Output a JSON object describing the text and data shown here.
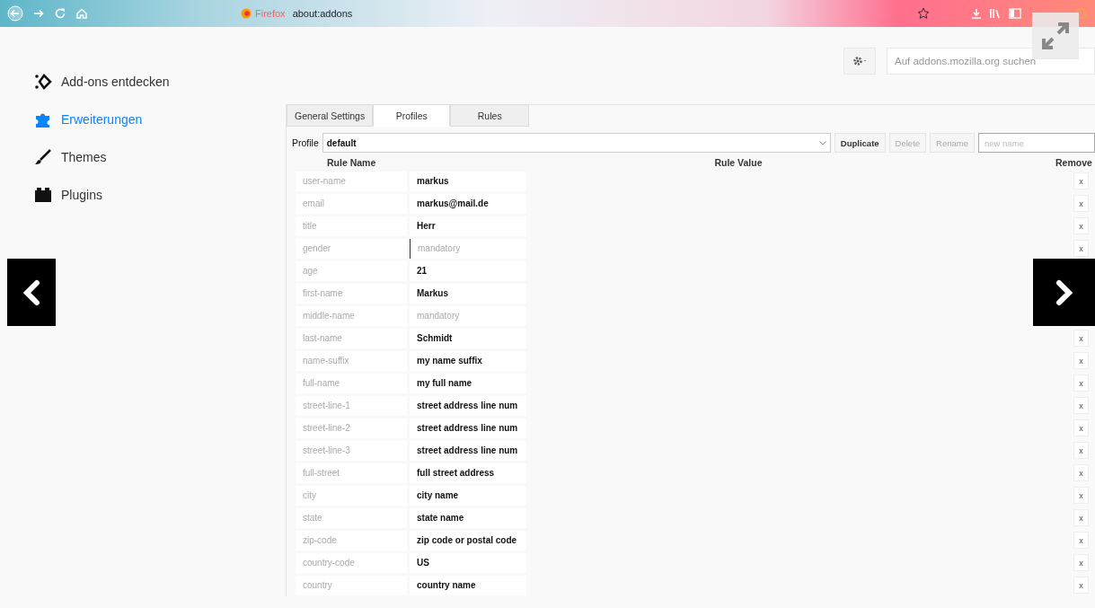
{
  "browser": {
    "identity_label": "Firefox",
    "url": "about:addons"
  },
  "sidebar": {
    "items": [
      {
        "label": "Add-ons entdecken",
        "selected": false
      },
      {
        "label": "Erweiterungen",
        "selected": true
      },
      {
        "label": "Themes",
        "selected": false
      },
      {
        "label": "Plugins",
        "selected": false
      }
    ]
  },
  "search": {
    "placeholder": "Auf addons.mozilla.org suchen"
  },
  "tabs": [
    {
      "label": "General Settings",
      "selected": false
    },
    {
      "label": "Profiles",
      "selected": true
    },
    {
      "label": "Rules",
      "selected": false
    }
  ],
  "profile": {
    "label": "Profile",
    "value": "default",
    "buttons": [
      {
        "label": "Duplicate",
        "disabled": false
      },
      {
        "label": "Delete",
        "disabled": true
      },
      {
        "label": "Rename",
        "disabled": true
      }
    ],
    "new_name": {
      "placeholder": "new name"
    }
  },
  "table": {
    "columns": [
      "Rule Name",
      "Rule Value",
      "Remove"
    ],
    "rows": [
      {
        "name": "user-name",
        "value": "markus",
        "remove": "x"
      },
      {
        "name": "email",
        "value": "markus@mail.de",
        "remove": "x"
      },
      {
        "name": "title",
        "value": "Herr",
        "remove": "x"
      },
      {
        "name": "gender",
        "placeholder": "mandatory",
        "focused": true,
        "remove": "x"
      },
      {
        "name": "age",
        "value": "21"
      },
      {
        "name": "first-name",
        "value": "Markus"
      },
      {
        "name": "middle-name",
        "placeholder": "mandatory",
        "focused": false
      },
      {
        "name": "last-name",
        "value": "Schmidt",
        "remove": "x"
      },
      {
        "name": "name-suffix",
        "value": "my name suffix",
        "remove": "x"
      },
      {
        "name": "full-name",
        "value": "my full name",
        "remove": "x"
      },
      {
        "name": "street-line-1",
        "value": "street address line num",
        "remove": "x"
      },
      {
        "name": "street-line-2",
        "value": "street address line num",
        "remove": "x"
      },
      {
        "name": "street-line-3",
        "value": "street address line num",
        "remove": "x"
      },
      {
        "name": "full-street",
        "value": "full street address",
        "remove": "x"
      },
      {
        "name": "city",
        "value": "city name",
        "remove": "x"
      },
      {
        "name": "state",
        "value": "state name",
        "remove": "x"
      },
      {
        "name": "zip-code",
        "value": "zip code or postal code",
        "remove": "x"
      },
      {
        "name": "country-code",
        "value": "US",
        "remove": "x"
      },
      {
        "name": "country",
        "value": "country name",
        "remove": "x"
      }
    ]
  }
}
